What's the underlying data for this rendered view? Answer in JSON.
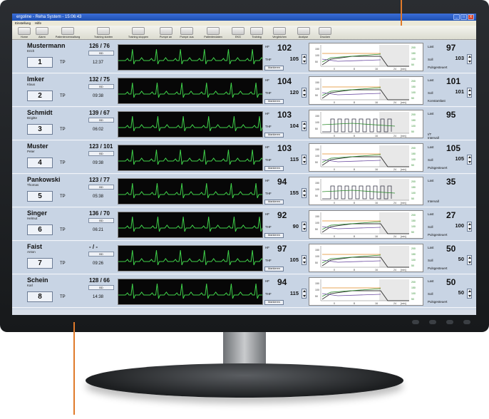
{
  "window": {
    "title": "ergoline - Reha System - 15:06:43",
    "controls": [
      "_",
      "□",
      "X"
    ]
  },
  "menu": [
    "Einstellung",
    "Hilfe"
  ],
  "toolbar": [
    "Home",
    "Alarm",
    "Patientenverwaltung",
    "Training starten",
    "Training stoppen",
    "Pumpe an",
    "Pumpe aus",
    "Patientendaten",
    "EKG",
    "Training",
    "Vergleichen",
    "Analyse",
    "Drucken"
  ],
  "labels": {
    "hf": "HF",
    "thf": "THF",
    "last": "Last",
    "soll": "Soll",
    "bd": "BD",
    "markieren": "Markieren",
    "tp": "TP"
  },
  "patients": [
    {
      "name": "Mustermann",
      "first": "Erich",
      "bp": "126 / 76",
      "number": "1",
      "time": "12:37",
      "hf": "102",
      "thf": "105",
      "last": "97",
      "soll": "103",
      "mode": "Pulsgesteuert",
      "graph": "steady"
    },
    {
      "name": "Imker",
      "first": "Klaus",
      "bp": "132 / 75",
      "number": "2",
      "time": "09:38",
      "hf": "104",
      "thf": "120",
      "last": "101",
      "soll": "101",
      "mode": "Konstantlast",
      "graph": "steady"
    },
    {
      "name": "Schmidt",
      "first": "Brigitte",
      "bp": "139 / 67",
      "number": "3",
      "time": "06:02",
      "hf": "103",
      "thf": "104",
      "last": "95",
      "soll": "",
      "mode": "I/T\nIntervall",
      "graph": "interval"
    },
    {
      "name": "Muster",
      "first": "Peter",
      "bp": "123 / 101",
      "number": "4",
      "time": "09:38",
      "hf": "103",
      "thf": "115",
      "last": "105",
      "soll": "105",
      "mode": "Pulsgesteuert",
      "graph": "steady"
    },
    {
      "name": "Pankowski",
      "first": "Thomas",
      "bp": "123 / 77",
      "number": "5",
      "time": "05:38",
      "hf": "94",
      "thf": "155",
      "last": "35",
      "soll": "",
      "mode": "Intervall",
      "graph": "interval"
    },
    {
      "name": "Singer",
      "first": "Helmut",
      "bp": "136 / 70",
      "number": "6",
      "time": "06:21",
      "hf": "92",
      "thf": "90",
      "last": "27",
      "soll": "100",
      "mode": "Pulsgesteuert",
      "graph": "steady"
    },
    {
      "name": "Faist",
      "first": "Anton",
      "bp": "- / -",
      "number": "7",
      "time": "09:26",
      "hf": "97",
      "thf": "105",
      "last": "50",
      "soll": "50",
      "mode": "Pulsgesteuert",
      "graph": "steady"
    },
    {
      "name": "Schein",
      "first": "Karl",
      "bp": "128 / 66",
      "number": "8",
      "time": "14:38",
      "hf": "94",
      "thf": "115",
      "last": "50",
      "soll": "50",
      "mode": "Pulsgesteuert",
      "graph": "steady"
    }
  ],
  "graph_axis": {
    "x_ticks": [
      "0",
      "8",
      "16",
      "24",
      "[min]"
    ],
    "y_left": [
      "150",
      "100",
      "50"
    ],
    "y_right": [
      "200",
      "150",
      "100",
      "50"
    ]
  },
  "colors": {
    "bezel": "#1c1e20",
    "screen": "#cfd9e6",
    "row": "#c8d4e4",
    "ecg_trace": "#3fd24a",
    "callout": "#e07a2a",
    "titlebar": "#2556c2"
  },
  "icons": [
    "home-icon",
    "alarm-icon",
    "people-icon",
    "play-icon",
    "stop-icon",
    "pump-icon",
    "pump-off-icon",
    "patient-data-icon",
    "ecg-icon",
    "training-icon",
    "compare-icon",
    "analysis-icon",
    "print-icon"
  ]
}
